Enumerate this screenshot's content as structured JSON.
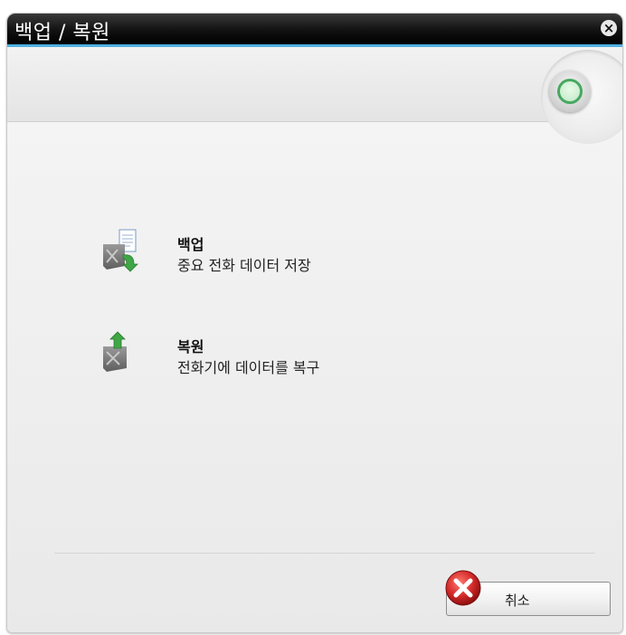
{
  "window": {
    "title": "백업 / 복원",
    "close_icon": "close-icon"
  },
  "options": [
    {
      "title": "백업",
      "description": "중요 전화 데이터 저장",
      "icon": "backup-icon"
    },
    {
      "title": "복원",
      "description": "전화기에 데이터를 복구",
      "icon": "restore-icon"
    }
  ],
  "footer": {
    "cancel_label": "취소",
    "cancel_icon": "cancel-icon"
  },
  "colors": {
    "accent": "#4fb0e0",
    "status_green": "#48a862",
    "cancel_red": "#d42a2a"
  }
}
